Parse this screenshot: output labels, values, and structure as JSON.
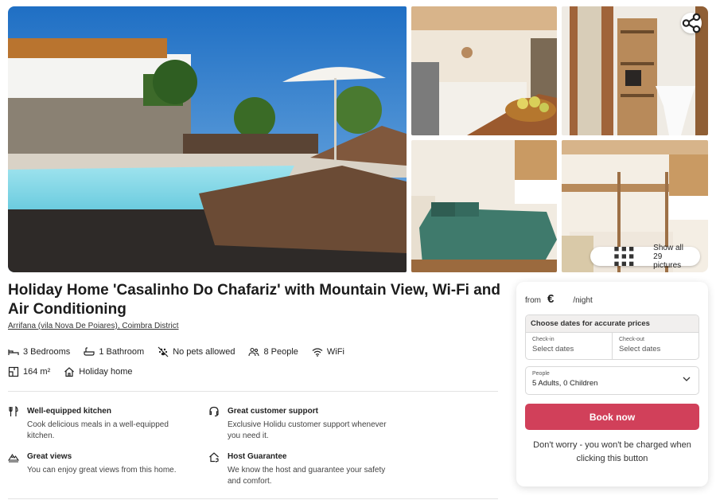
{
  "gallery": {
    "show_all_label": "Show all 29 pictures"
  },
  "listing": {
    "title": "Holiday Home 'Casalinho Do Chafariz' with Mountain View, Wi-Fi and Air Conditioning",
    "location": "Arrifana (vila Nova De Poiares), Coimbra District",
    "features_row1": [
      {
        "icon": "bed-icon",
        "label": "3 Bedrooms"
      },
      {
        "icon": "bathtub-icon",
        "label": "1 Bathroom"
      },
      {
        "icon": "no-pets-icon",
        "label": "No pets allowed"
      },
      {
        "icon": "people-icon",
        "label": "8 People"
      },
      {
        "icon": "wifi-icon",
        "label": "WiFi"
      }
    ],
    "features_row2": [
      {
        "icon": "floor-plan-icon",
        "label": "164 m²"
      },
      {
        "icon": "house-icon",
        "label": "Holiday home"
      }
    ]
  },
  "highlights": [
    {
      "icon": "cutlery-icon",
      "title": "Well-equipped kitchen",
      "desc": "Cook delicious meals in a well-equipped kitchen."
    },
    {
      "icon": "headset-icon",
      "title": "Great customer support",
      "desc": "Exclusive Holidu customer support whenever you need it."
    },
    {
      "icon": "mountain-icon",
      "title": "Great views",
      "desc": "You can enjoy great views from this home."
    },
    {
      "icon": "home-shield-icon",
      "title": "Host Guarantee",
      "desc": "We know the host and guarantee your safety and comfort."
    }
  ],
  "booking": {
    "from_label": "from",
    "currency": "€",
    "per_night": "/night",
    "dates_header": "Choose dates for accurate prices",
    "checkin_label": "Check-in",
    "checkin_value": "Select dates",
    "checkout_label": "Check-out",
    "checkout_value": "Select dates",
    "people_label": "People",
    "people_value": "5 Adults, 0 Children",
    "book_label": "Book now",
    "note": "Don't worry - you won't be charged when clicking this button"
  },
  "colors": {
    "accent": "#d1405a",
    "card_header_bg": "#f1efee"
  }
}
